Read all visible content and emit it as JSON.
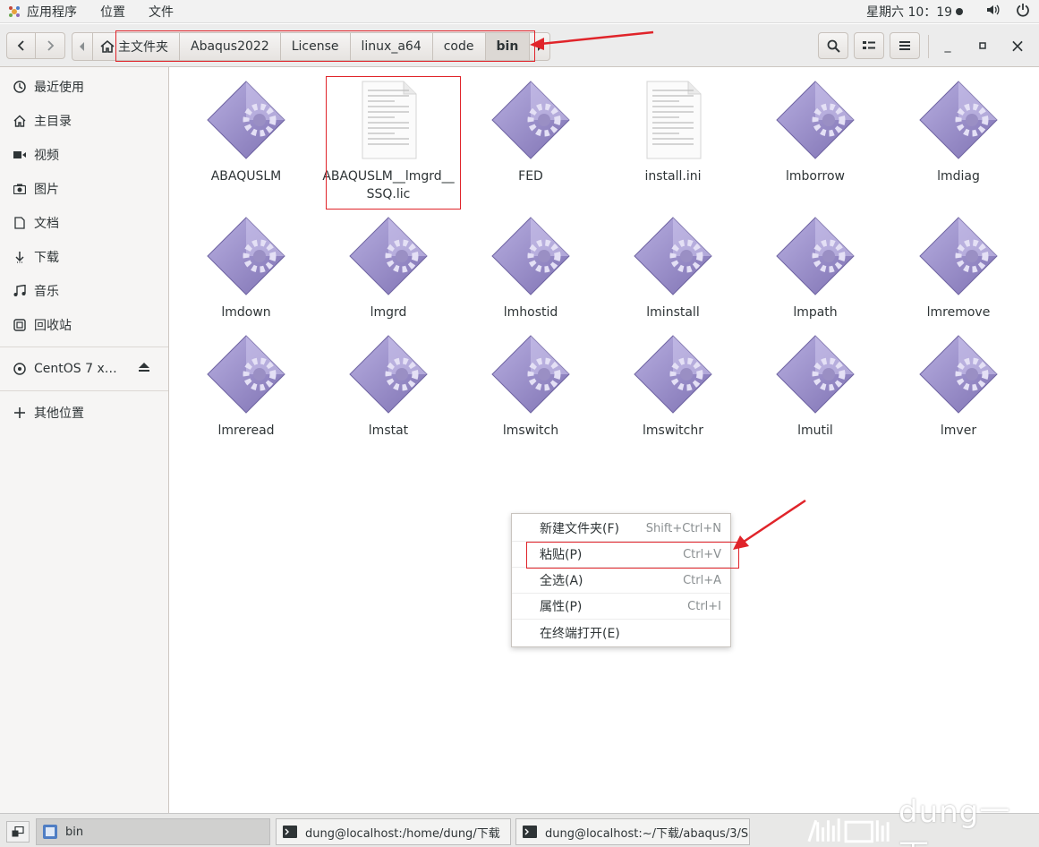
{
  "top_panel": {
    "apps_label": "应用程序",
    "places_label": "位置",
    "files_label": "文件",
    "clock": "星期六 10：19",
    "volume_icon": "volume-icon",
    "power_icon": "power-icon"
  },
  "headerbar": {
    "back_icon": "back-icon",
    "forward_icon": "forward-icon",
    "breadcrumbs": [
      "主文件夹",
      "Abaqus2022",
      "License",
      "linux_a64",
      "code",
      "bin"
    ],
    "search_icon": "search-icon",
    "view_icon": "list-view-icon",
    "menu_icon": "hamburger-icon",
    "minimize": "_",
    "maximize": "▫",
    "close": "×"
  },
  "sidebar": {
    "items": [
      {
        "label": "最近使用",
        "icon": "clock-icon"
      },
      {
        "label": "主目录",
        "icon": "home-icon"
      },
      {
        "label": "视频",
        "icon": "video-icon"
      },
      {
        "label": "图片",
        "icon": "camera-icon"
      },
      {
        "label": "文档",
        "icon": "document-icon"
      },
      {
        "label": "下载",
        "icon": "download-icon"
      },
      {
        "label": "音乐",
        "icon": "music-icon"
      },
      {
        "label": "回收站",
        "icon": "trash-icon"
      }
    ],
    "device": {
      "label": "CentOS 7 x…",
      "icon": "disc-icon"
    },
    "other": {
      "label": "其他位置",
      "icon": "plus-icon"
    }
  },
  "files": [
    {
      "name": "ABAQUSLM",
      "type": "exec"
    },
    {
      "name": "ABAQUSLM__lmgrd__SSQ.lic",
      "type": "text"
    },
    {
      "name": "FED",
      "type": "exec"
    },
    {
      "name": "install.ini",
      "type": "text"
    },
    {
      "name": "lmborrow",
      "type": "exec"
    },
    {
      "name": "lmdiag",
      "type": "exec"
    },
    {
      "name": "lmdown",
      "type": "exec"
    },
    {
      "name": "lmgrd",
      "type": "exec"
    },
    {
      "name": "lmhostid",
      "type": "exec"
    },
    {
      "name": "lminstall",
      "type": "exec"
    },
    {
      "name": "lmpath",
      "type": "exec"
    },
    {
      "name": "lmremove",
      "type": "exec"
    },
    {
      "name": "lmreread",
      "type": "exec"
    },
    {
      "name": "lmstat",
      "type": "exec"
    },
    {
      "name": "lmswitch",
      "type": "exec"
    },
    {
      "name": "lmswitchr",
      "type": "exec"
    },
    {
      "name": "lmutil",
      "type": "exec"
    },
    {
      "name": "lmver",
      "type": "exec"
    }
  ],
  "context_menu": [
    {
      "label": "新建文件夹(F)",
      "shortcut": "Shift+Ctrl+N"
    },
    {
      "label": "粘贴(P)",
      "shortcut": "Ctrl+V"
    },
    {
      "label": "全选(A)",
      "shortcut": "Ctrl+A"
    },
    {
      "label": "属性(P)",
      "shortcut": "Ctrl+I"
    },
    {
      "label": "在终端打开(E)",
      "shortcut": ""
    }
  ],
  "taskbar": {
    "tasks": [
      {
        "label": "bin"
      },
      {
        "label": "dung@localhost:/home/dung/下载"
      },
      {
        "label": "dung@localhost:~/下载/abaqus/3/S…"
      }
    ],
    "watermark": "dung一下"
  },
  "colors": {
    "annotation_red": "#e0242a",
    "icon_purple": "#9a8fc4"
  }
}
